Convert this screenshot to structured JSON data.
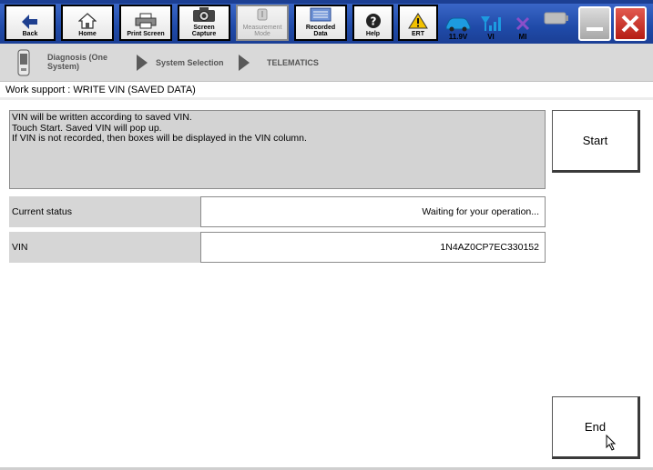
{
  "toolbar": {
    "back": "Back",
    "home": "Home",
    "print_screen": "Print Screen",
    "screen_capture": "Screen\nCapture",
    "measurement_mode": "Measurement\nMode",
    "recorded_data": "Recorded\nData",
    "help": "Help",
    "ert": "ERT"
  },
  "status": {
    "battery_voltage": "11.9V",
    "vi": "VI",
    "mi": "MI"
  },
  "breadcrumb": {
    "step1": "Diagnosis (One\nSystem)",
    "step2": "System Selection",
    "step3": "TELEMATICS"
  },
  "page_title": "Work support : WRITE VIN (SAVED DATA)",
  "message": {
    "line1": "VIN will be written according to saved VIN.",
    "line2": "Touch Start. Saved VIN will pop up.",
    "line3": "If VIN is not recorded, then boxes will be displayed in the VIN column."
  },
  "rows": [
    {
      "label": "Current status",
      "value": "Waiting for your operation..."
    },
    {
      "label": "VIN",
      "value": "1N4AZ0CP7EC330152"
    }
  ],
  "buttons": {
    "start": "Start",
    "end": "End"
  },
  "colors": {
    "toolbar_blue": "#1f4aa8",
    "close_red": "#c0281e",
    "warning_yellow": "#f2c200",
    "mi_purple": "#8a4fc9",
    "gray_panel": "#d3d3d3"
  }
}
